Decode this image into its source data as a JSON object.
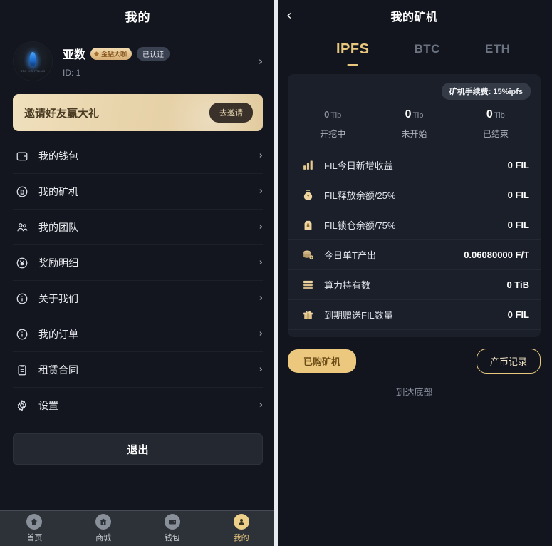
{
  "left": {
    "header_title": "我的",
    "profile": {
      "avatar_icon": "flame-avatar",
      "username": "亚数",
      "vip_badge": "金钻大咖",
      "vip_gem_icon": "diamond-icon",
      "verified_badge": "已认证",
      "uid_label": "ID: 1",
      "chevron": "›"
    },
    "invite": {
      "text": "邀请好友赢大礼",
      "button_label": "去邀请"
    },
    "menu": [
      {
        "label": "我的钱包",
        "icon": "wallet-icon",
        "chevron": "›"
      },
      {
        "label": "我的矿机",
        "icon": "bitcoin-circle-icon",
        "chevron": "›"
      },
      {
        "label": "我的团队",
        "icon": "users-icon",
        "chevron": "›"
      },
      {
        "label": "奖励明细",
        "icon": "yen-circle-icon",
        "chevron": "›"
      },
      {
        "label": "关于我们",
        "icon": "info-circle-icon",
        "chevron": "›"
      },
      {
        "label": "我的订单",
        "icon": "info-circle-icon",
        "chevron": "›"
      },
      {
        "label": "租赁合同",
        "icon": "clipboard-icon",
        "chevron": "›"
      },
      {
        "label": "设置",
        "icon": "gear-icon",
        "chevron": "›"
      }
    ],
    "logout_label": "退出",
    "tabbar": [
      {
        "label": "首页",
        "icon": "home-icon",
        "active": false
      },
      {
        "label": "商城",
        "icon": "store-icon",
        "active": false
      },
      {
        "label": "钱包",
        "icon": "wallet-icon",
        "active": false
      },
      {
        "label": "我的",
        "icon": "user-icon",
        "active": true
      }
    ]
  },
  "right": {
    "back_icon": "chevron-left-icon",
    "header_title": "我的矿机",
    "coin_tabs": [
      {
        "label": "IPFS",
        "active": true
      },
      {
        "label": "BTC",
        "active": false
      },
      {
        "label": "ETH",
        "active": false
      }
    ],
    "fee_badge": "矿机手续费: 15%ipfs",
    "stats": [
      {
        "value": "0",
        "unit": "Tib",
        "label": "开挖中",
        "dim": true
      },
      {
        "value": "0",
        "unit": "Tib",
        "label": "未开始",
        "dim": false
      },
      {
        "value": "0",
        "unit": "Tib",
        "label": "已结束",
        "dim": false
      }
    ],
    "details": [
      {
        "label": "FIL今日新增收益",
        "value": "0 FIL",
        "icon": "bar-chart-icon"
      },
      {
        "label": "FIL释放余额/25%",
        "value": "0 FIL",
        "icon": "money-bag-icon"
      },
      {
        "label": "FIL锁仓余额/75%",
        "value": "0 FIL",
        "icon": "lock-bag-icon"
      },
      {
        "label": "今日单T产出",
        "value": "0.06080000 F/T",
        "icon": "coins-plus-icon"
      },
      {
        "label": "算力持有数",
        "value": "0 TiB",
        "icon": "server-icon"
      },
      {
        "label": "到期赠送FIL数量",
        "value": "0 FIL",
        "icon": "gift-icon"
      }
    ],
    "purchased_button": "已购矿机",
    "records_button": "产币记录",
    "bottom_note": "到达底部"
  },
  "colors": {
    "gold": "#e9c87e",
    "panel_bg": "#13161f",
    "card_bg": "#1b1f29",
    "muted": "#8b93a1"
  }
}
